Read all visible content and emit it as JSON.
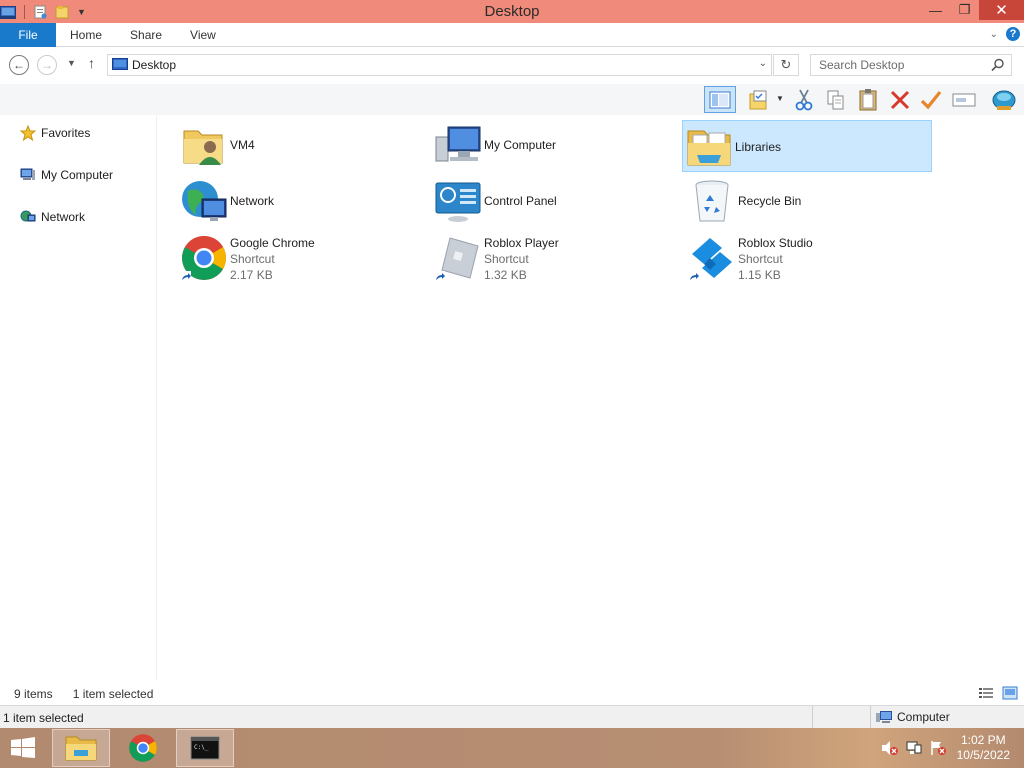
{
  "window": {
    "title": "Desktop",
    "minimize": "—",
    "restore": "❐",
    "close": "✕"
  },
  "ribbon": {
    "file": "File",
    "tabs": [
      "Home",
      "Share",
      "View"
    ]
  },
  "address": {
    "path": "Desktop",
    "search_placeholder": "Search Desktop"
  },
  "nav": {
    "favorites": "Favorites",
    "my_computer": "My Computer",
    "network": "Network"
  },
  "items": [
    {
      "name": "VM4",
      "icon": "user-folder-icon"
    },
    {
      "name": "My Computer",
      "icon": "computer-icon"
    },
    {
      "name": "Libraries",
      "icon": "libraries-icon",
      "selected": true
    },
    {
      "name": "Network",
      "icon": "network-icon"
    },
    {
      "name": "Control Panel",
      "icon": "control-panel-icon"
    },
    {
      "name": "Recycle Bin",
      "icon": "recycle-bin-icon"
    },
    {
      "name": "Google Chrome",
      "type": "Shortcut",
      "size": "2.17 KB",
      "icon": "chrome-icon"
    },
    {
      "name": "Roblox Player",
      "type": "Shortcut",
      "size": "1.32 KB",
      "icon": "roblox-player-icon"
    },
    {
      "name": "Roblox Studio",
      "type": "Shortcut",
      "size": "1.15 KB",
      "icon": "roblox-studio-icon"
    }
  ],
  "status": {
    "item_count": "9 items",
    "selected": "1 item selected",
    "bottom_left": "1 item selected",
    "bottom_right": "Computer"
  },
  "taskbar": {
    "time": "1:02 PM",
    "date": "10/5/2022"
  },
  "colors": {
    "titlebar": "#f08a7a",
    "file_tab": "#1979ca",
    "selection": "#cce8ff"
  }
}
